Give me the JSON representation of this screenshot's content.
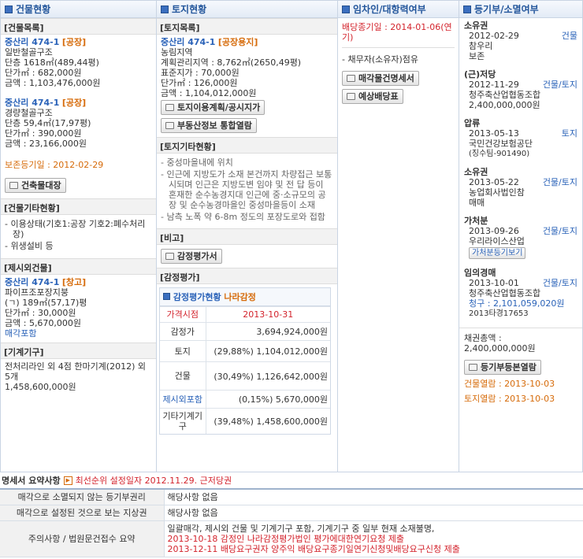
{
  "headers": {
    "building": "건물현황",
    "land": "토지현황",
    "tenant": "임차인/대항력여부",
    "registry": "등기부/소멸여부"
  },
  "building": {
    "list_title": "[건물목록]",
    "items": [
      {
        "addr": "중산리 474-1",
        "tag": "[공장]",
        "struct": "일반철골구조",
        "area": "단층 1618㎡(489,44평)",
        "unit": "단가㎡ : 682,000원",
        "amount": "금액 : 1,103,476,000원"
      },
      {
        "addr": "중산리 474-1",
        "tag": "[공장]",
        "struct": "경량철골구조",
        "area": "단층 59,4㎡(17,97평)",
        "unit": "단가㎡ : 390,000원",
        "amount": "금액 : 23,166,000원"
      }
    ],
    "preserve": "보존등기일 : 2012-02-29",
    "ledger_btn": "건축물대장",
    "etc_title": "[건물기타현황]",
    "etc_items": [
      "이용상태(기호1:공장 기호2:폐수처리장)",
      "위생설비 등"
    ],
    "extra_title": "[제시외건물]",
    "extra": {
      "addr": "중산리 474-1",
      "tag": "[창고]",
      "struct": "파이프조포장지붕",
      "area": "(ㄱ) 189㎡(57,17)평",
      "unit": "단가㎡ : 30,000원",
      "amount": "금액 : 5,670,000원",
      "note": "매각포함"
    },
    "machine_title": "[기계기구]",
    "machine_desc": "전처리라인 외 4점 한마기계(2012) 외 5개",
    "machine_amount": "1,458,600,000원"
  },
  "land": {
    "list_title": "[토지목록]",
    "addr": "중산리 474-1",
    "tag": "[공장용지]",
    "lines": [
      "농림지역",
      "계획관리지역 : 8,762㎡(2650,49평)",
      "표준지가 : 70,000원",
      "단가㎡ : 126,000원",
      "금액 : 1,104,012,000원"
    ],
    "plan_btn": "토지이용계획/공시지가",
    "info_btn": "부동산정보 통합열람",
    "etc_title": "[토지기타현황]",
    "etc_items": [
      "중성마을내에 위치",
      "인근에 지방도가 소재 본건까지 차량접근 보통시되며 인근은 지방도변 임야 및 전 답 등이 혼재한 순수농경지대 인근에 중·소규모의 공장 및 순수농경마을인 중성마을등이 소재",
      "남측 노폭 약 6-8m 정도의 포장도로와 접함"
    ],
    "note_title": "[비고]",
    "appraisal_btn": "감정평가서",
    "appraisal_title": "[감정평가]",
    "appraisal_box_title": "감정평가현황",
    "appraiser": "나라감정",
    "rows": [
      {
        "k": "가격시점",
        "v": "2013-10-31",
        "hl": true
      },
      {
        "k": "감정가",
        "v": "3,694,924,000원"
      },
      {
        "k": "토지",
        "v": "(29,88%) 1,104,012,000원"
      },
      {
        "k": "건물",
        "v": "(30,49%) 1,126,642,000원"
      },
      {
        "k": "제시외포함",
        "v": "(0,15%) 5,670,000원",
        "blue": true
      },
      {
        "k": "기타기계기구",
        "v": "(39,48%) 1,458,600,000원"
      }
    ]
  },
  "tenant": {
    "deadline": "배당종기일 : 2014-01-06(연기)",
    "item": "채무자(소유자)점유",
    "btn1": "매각물건명세서",
    "btn2": "예상배당표"
  },
  "registry": {
    "entries": [
      {
        "title": "소유권",
        "date": "2012-02-29",
        "kind": "건물",
        "name": "참우리",
        "extra": "보존"
      },
      {
        "title": "(근)저당",
        "date": "2012-11-29",
        "kind": "건물/토지",
        "name": "청주축산업협동조합",
        "extra": "2,400,000,000원"
      },
      {
        "title": "압류",
        "date": "2013-05-13",
        "kind": "토지",
        "name": "국민건강보험공단",
        "extra": "(징수팀-901490)"
      },
      {
        "title": "소유권",
        "date": "2013-05-22",
        "kind": "건물/토지",
        "name": "농업회사법인참",
        "extra": "매매"
      },
      {
        "title": "가처분",
        "date": "2013-09-26",
        "kind": "건물/토지",
        "name": "우리라이스산업",
        "extra": "가처분등기보기"
      },
      {
        "title": "임의경매",
        "date": "2013-10-01",
        "kind": "건물/토지",
        "name": "청주축산업협동조합",
        "claim": "청구 : 2,101,059,020원",
        "extra": "2013타경17653"
      }
    ],
    "total_label": "채권총액 :",
    "total": "2,400,000,000원",
    "btn": "등기부등본열람",
    "view1": "건물열람 : 2013-10-03",
    "view2": "토지열람 : 2013-10-03"
  },
  "summary": {
    "title": "명세서 요약사항",
    "first_right": "최선순위 설정일자 2012.11.29. 근저당권",
    "rows": [
      {
        "k": "매각으로 소멸되지 않는 등기부권리",
        "lines": [
          {
            "t": "해당사항 없음"
          }
        ]
      },
      {
        "k": "매각으로 설정된 것으로 보는 지상권",
        "lines": [
          {
            "t": "해당사항 없음"
          }
        ]
      },
      {
        "k": "주의사항 / 법원문건접수 요약",
        "lines": [
          {
            "t": "일괄매각, 제시외 건물 및 기계기구 포함, 기계기구 중 일부 현재 소재불명,"
          },
          {
            "t": "2013-10-18 감정인 나라감정평가법인 평가에대한연기요청 제출",
            "red": true
          },
          {
            "t": "2013-12-11 배당요구권자 양주익 배당요구종기일연기신청및배당요구신청 제출",
            "red": true
          }
        ]
      }
    ]
  }
}
